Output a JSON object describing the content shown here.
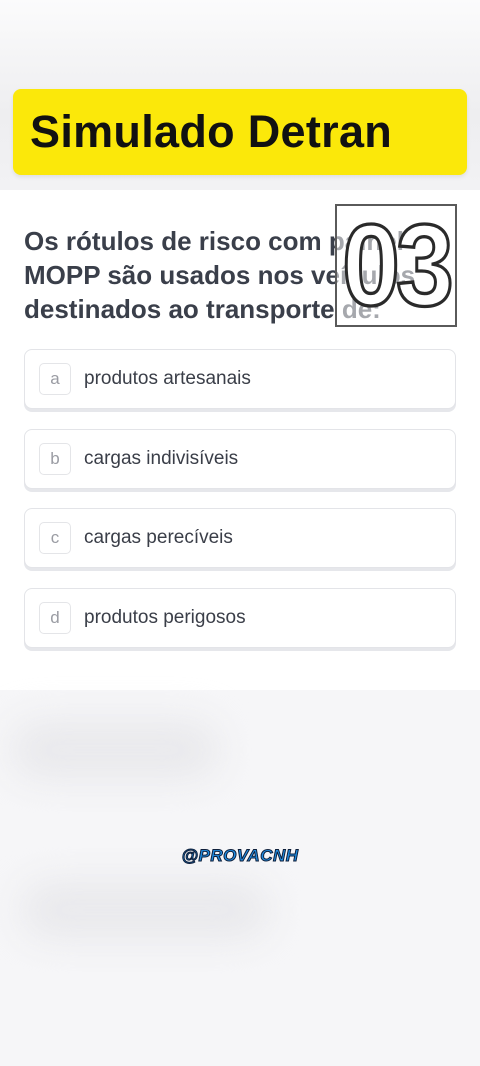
{
  "banner": {
    "title": "Simulado Detran"
  },
  "question": {
    "lines": [
      "Os rótulos de risco com painel",
      "MOPP são usados nos veículos",
      "destinados ao transporte de:"
    ],
    "number_badge": "03"
  },
  "options": [
    {
      "letter": "a",
      "text": "produtos artesanais"
    },
    {
      "letter": "b",
      "text": "cargas indivisíveis"
    },
    {
      "letter": "c",
      "text": "cargas perecíveis"
    },
    {
      "letter": "d",
      "text": "produtos perigosos"
    }
  ],
  "watermark": {
    "handle": "@PROVACNH"
  }
}
